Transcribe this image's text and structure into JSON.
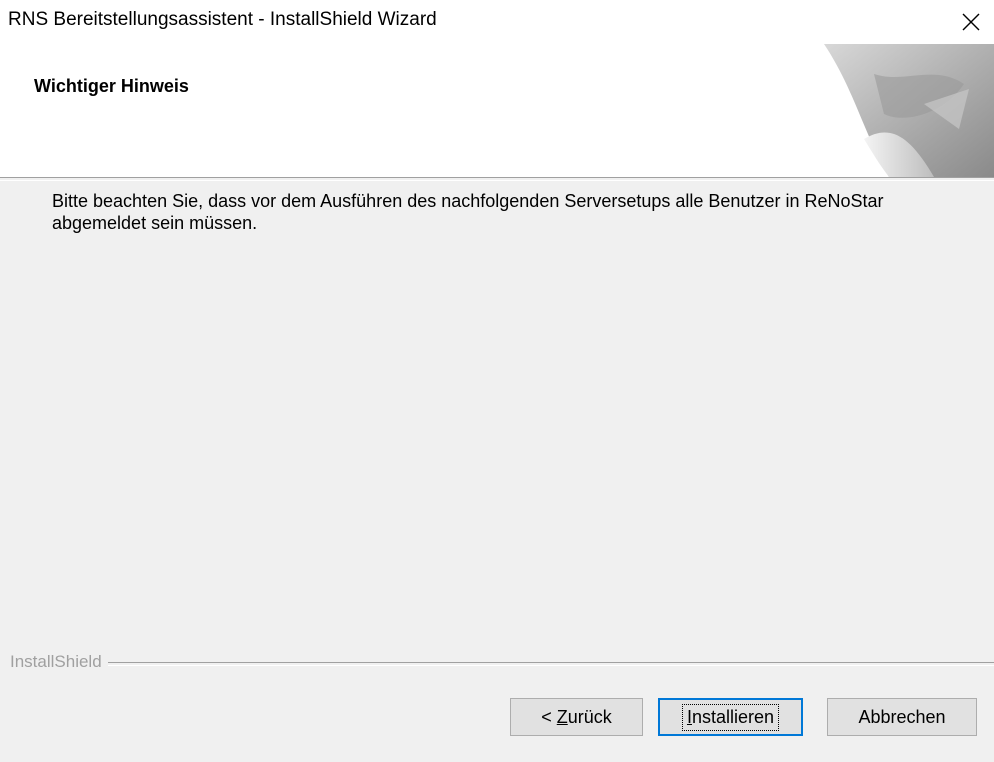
{
  "window": {
    "title": "RNS Bereitstellungsassistent - InstallShield Wizard",
    "close_icon": "close-icon"
  },
  "header": {
    "title": "Wichtiger Hinweis"
  },
  "body": {
    "message": "Bitte beachten Sie, dass vor dem Ausführen des nachfolgenden Serversetups alle Benutzer in ReNoStar abgemeldet sein müssen."
  },
  "footer": {
    "brand": "InstallShield"
  },
  "buttons": {
    "back_prefix": "< ",
    "back_mnemonic": "Z",
    "back_rest": "urück",
    "install_mnemonic": "I",
    "install_rest": "nstallieren",
    "cancel_label": "Abbrechen"
  },
  "colors": {
    "focus_border": "#0078d7",
    "button_face": "#e1e1e1",
    "dialog_bg": "#f0f0f0"
  }
}
